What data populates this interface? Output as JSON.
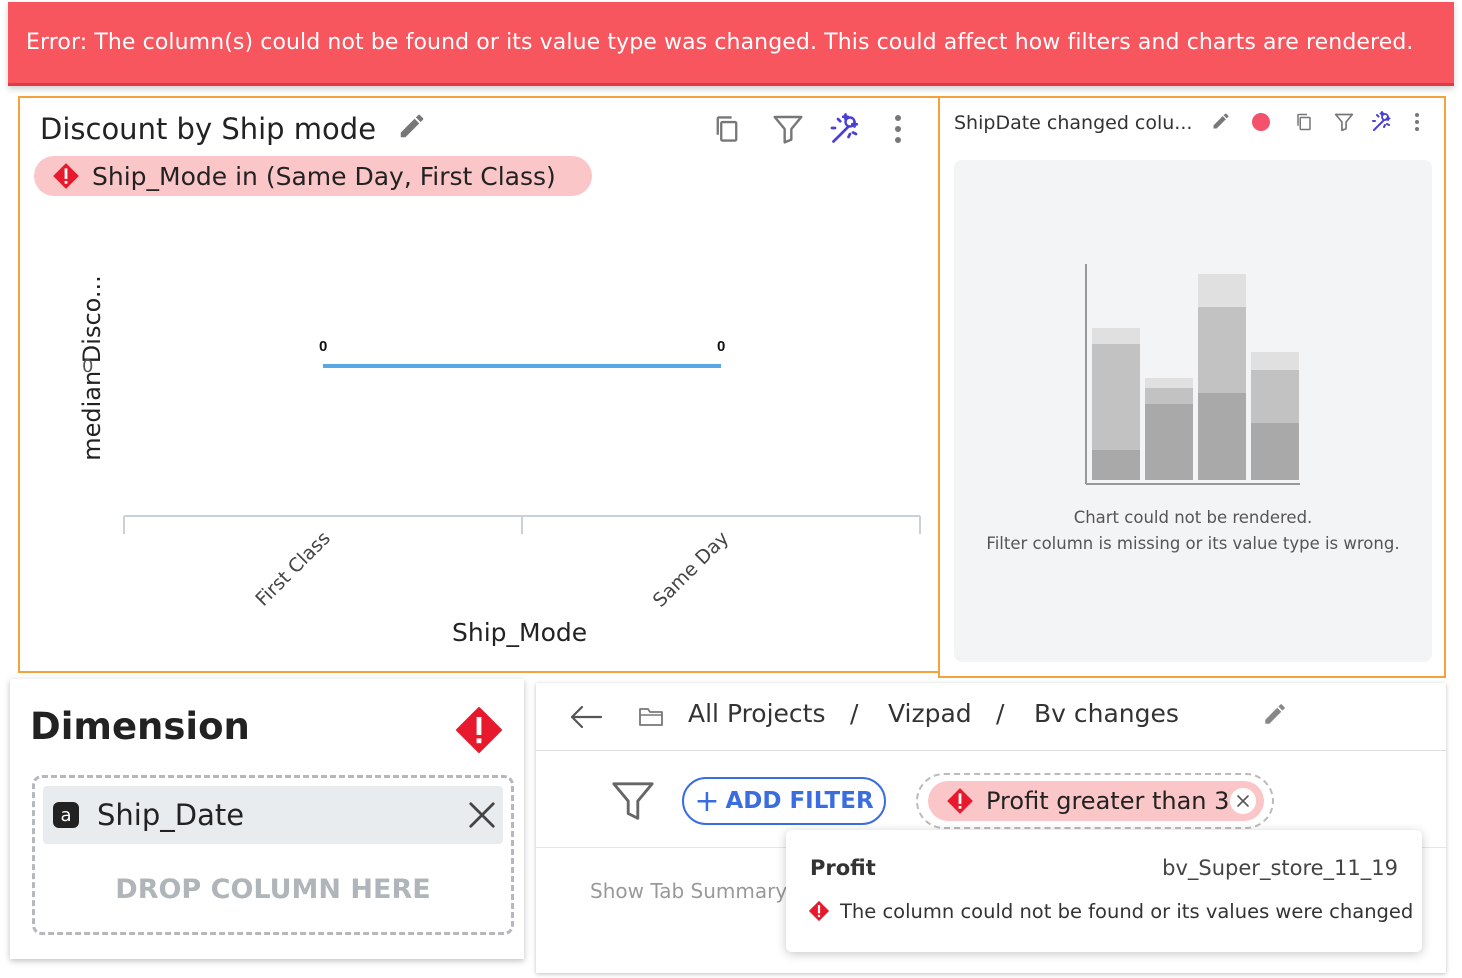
{
  "banner": {
    "message": "Error: The column(s) could not be found or its value type was changed. This could affect how filters and charts are rendered."
  },
  "main_chart": {
    "title": "Discount by Ship mode",
    "filter_chip": "Ship_Mode in (Same Day, First Class)",
    "icons": [
      "edit-icon",
      "copy-icon",
      "filter-icon",
      "magic-wand-icon",
      "more-vertical-icon"
    ]
  },
  "chart_data": {
    "type": "line",
    "categories": [
      "First Class",
      "Same Day"
    ],
    "series": [
      {
        "values": [
          0,
          0
        ]
      }
    ],
    "data_labels": [
      "0",
      "0"
    ],
    "xlabel": "Ship_Mode",
    "ylabel": "median Disco...",
    "y_ticks": [
      "0"
    ],
    "line_color": "#5aa7e6"
  },
  "side_chart": {
    "title": "ShipDate changed colu...",
    "status_dot_color": "#f4516c",
    "message_line1": "Chart could not be rendered.",
    "message_line2": "Filter column is missing or its value type is wrong.",
    "icons": [
      "edit-icon",
      "status-dot",
      "copy-icon",
      "filter-icon",
      "magic-wand-icon",
      "more-vertical-icon"
    ]
  },
  "dimension": {
    "title": "Dimension",
    "field_type_badge": "a",
    "field_name": "Ship_Date",
    "drop_placeholder": "DROP COLUMN HERE"
  },
  "breadcrumb": {
    "items": [
      "All Projects",
      "Vizpad",
      "Bv changes"
    ],
    "separator": "/"
  },
  "filters": {
    "add_label": "ADD FILTER",
    "add_prefix": "+",
    "active_filter": "Profit greater than 3",
    "summary_text": "Show Tab Summary"
  },
  "tooltip": {
    "column": "Profit",
    "source": "bv_Super_store_11_19",
    "message": "The column could not be found or its values were changed"
  },
  "colors": {
    "banner": "#f7565f",
    "accent_orange": "#f4a23c",
    "error_red": "#e8192c",
    "chip_pink": "#fbc6c8",
    "primary_blue": "#3a6ee0",
    "magic_purple": "#4a3ed8"
  }
}
